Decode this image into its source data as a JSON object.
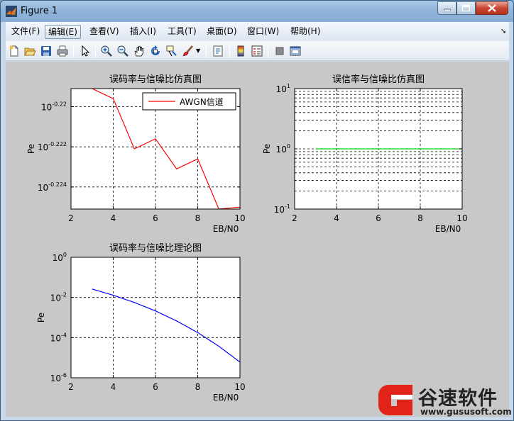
{
  "window": {
    "title": "Figure 1",
    "icon": "matlab-logo-icon"
  },
  "menu": {
    "items": [
      {
        "label": "文件(F)"
      },
      {
        "label": "编辑(E)"
      },
      {
        "label": "查看(V)"
      },
      {
        "label": "插入(I)"
      },
      {
        "label": "工具(T)"
      },
      {
        "label": "桌面(D)"
      },
      {
        "label": "窗口(W)"
      },
      {
        "label": "帮助(H)"
      }
    ],
    "overflow_icon": "menu-arrow-icon"
  },
  "toolbar": {
    "icons": [
      "new-figure-icon",
      "open-file-icon",
      "save-icon",
      "print-icon",
      "edit-plot-arrow-icon",
      "zoom-in-icon",
      "zoom-out-icon",
      "pan-hand-icon",
      "rotate-3d-icon",
      "data-cursor-icon",
      "brush-icon",
      "brush-dropdown-icon",
      "link-plot-icon",
      "insert-colorbar-icon",
      "insert-legend-icon",
      "hide-plot-tools-icon",
      "show-plot-tools-icon"
    ]
  },
  "watermark": {
    "text": "谷速软件",
    "url": "www.gususoft.com"
  },
  "chart_data": [
    {
      "type": "line",
      "title": "误码率与信噪比仿真图",
      "xlabel": "EB/N0",
      "ylabel": "Pe",
      "xlim": [
        2,
        10
      ],
      "xticks": [
        "2",
        "4",
        "6",
        "8",
        "10"
      ],
      "yscale": "log",
      "yticks": [
        {
          "base": "10",
          "exp": "-0.22"
        },
        {
          "base": "10",
          "exp": "-0.222"
        },
        {
          "base": "10",
          "exp": "-0.224"
        }
      ],
      "ylim_exp": [
        -0.2251,
        -0.2191
      ],
      "grid": true,
      "legend": {
        "position": "top-right",
        "entries": [
          "AWGN信道"
        ]
      },
      "series": [
        {
          "name": "AWGN信道",
          "color": "#ff0000",
          "x": [
            3,
            4,
            5,
            6,
            7,
            8,
            9,
            10
          ],
          "y_exp": [
            -0.2191,
            -0.2196,
            -0.2221,
            -0.2216,
            -0.2231,
            -0.2226,
            -0.2251,
            -0.225
          ]
        }
      ]
    },
    {
      "type": "line",
      "title": "误信率与信噪比仿真图",
      "xlabel": "EB/N0",
      "ylabel": "Pe",
      "xlim": [
        2,
        10
      ],
      "xticks": [
        "2",
        "4",
        "6",
        "8",
        "10"
      ],
      "yscale": "log",
      "ylim_exp": [
        -1,
        1
      ],
      "yticks": [
        {
          "base": "10",
          "exp": "-1"
        },
        {
          "base": "10",
          "exp": "0"
        },
        {
          "base": "10",
          "exp": "1"
        }
      ],
      "grid": true,
      "series": [
        {
          "color": "#00cc00",
          "x": [
            3,
            10
          ],
          "y_exp": [
            0,
            0
          ]
        }
      ]
    },
    {
      "type": "line",
      "title": "误码率与信噪比理论图",
      "xlabel": "EB/N0",
      "ylabel": "Pe",
      "xlim": [
        2,
        10
      ],
      "xticks": [
        "2",
        "4",
        "6",
        "8",
        "10"
      ],
      "yscale": "log",
      "ylim_exp": [
        -6,
        0
      ],
      "yticks": [
        {
          "base": "10",
          "exp": "0"
        },
        {
          "base": "10",
          "exp": "-2"
        },
        {
          "base": "10",
          "exp": "-4"
        },
        {
          "base": "10",
          "exp": "-6"
        }
      ],
      "grid": true,
      "series": [
        {
          "color": "#0000ff",
          "x": [
            3,
            4,
            5,
            6,
            7,
            8,
            9,
            10
          ],
          "y_exp": [
            -1.58,
            -1.89,
            -2.25,
            -2.67,
            -3.17,
            -3.75,
            -4.43,
            -5.22
          ]
        }
      ]
    }
  ]
}
